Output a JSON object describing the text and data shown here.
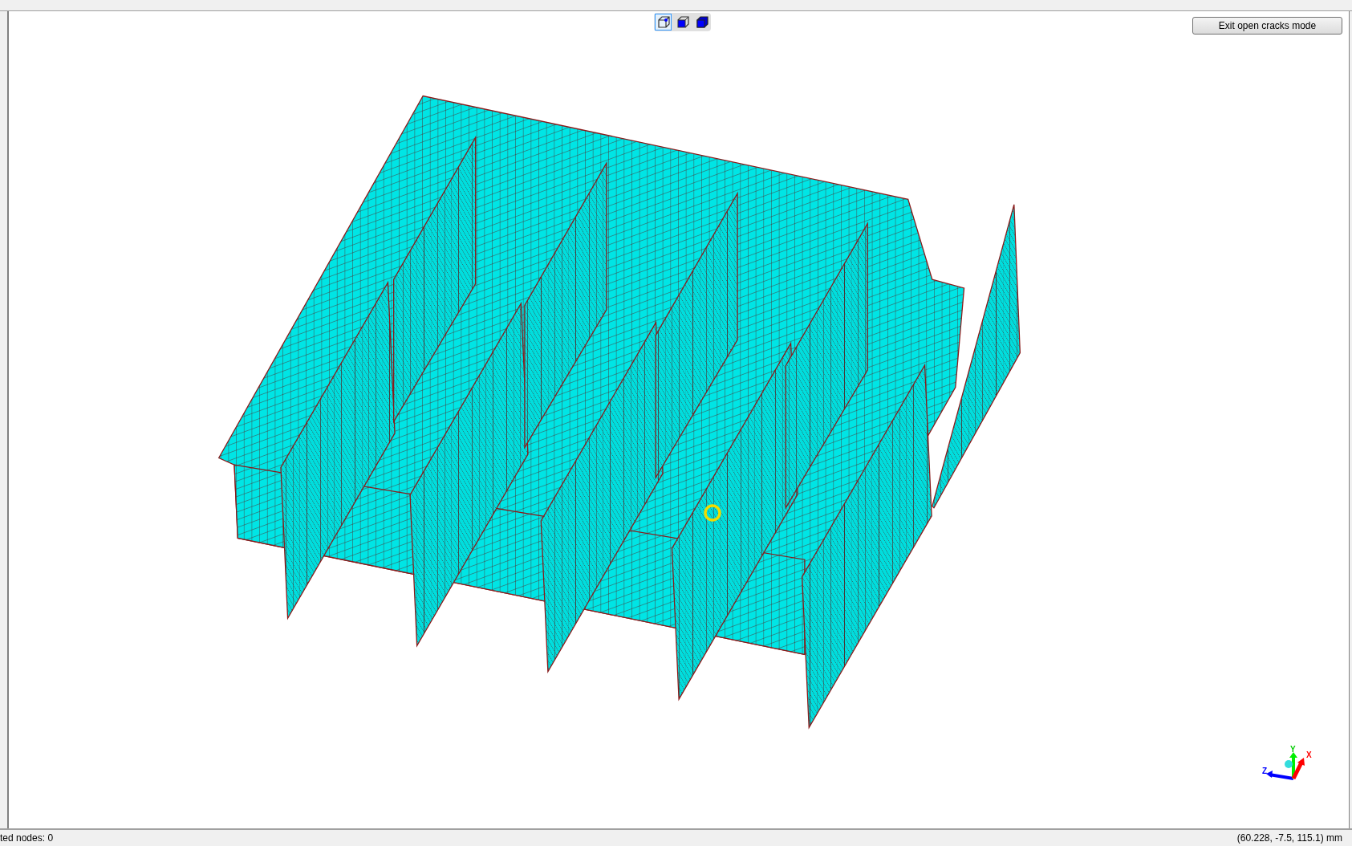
{
  "view_toolbar": [
    {
      "kind": "wireframe",
      "selected": true
    },
    {
      "kind": "solid",
      "selected": false
    },
    {
      "kind": "shaded",
      "selected": false
    }
  ],
  "exit_button": "Exit open cracks mode",
  "axis_labels": {
    "x": "X",
    "y": "Y",
    "z": "Z"
  },
  "status_bar": {
    "left": "ted nodes: 0",
    "right": "(60.228, -7.5, 115.1) mm"
  }
}
